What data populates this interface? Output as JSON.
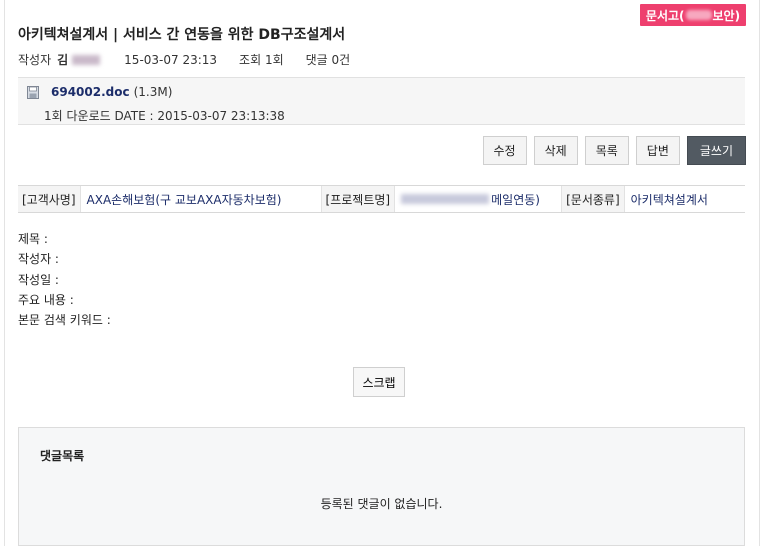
{
  "header": {
    "badge_prefix": "문서고(",
    "badge_suffix": "보안)",
    "title": "아키텍쳐설계서 | 서비스 간 연동을 위한 DB구조설계서"
  },
  "meta": {
    "author_label": "작성자",
    "author_initial": "김",
    "date": "15-03-07 23:13",
    "views": "조회 1회",
    "comments": "댓글 0건"
  },
  "attachment": {
    "icon": "floppy-disk-icon",
    "filename": "694002.doc",
    "size": "(1.3M)",
    "download_info": "1회 다운로드 DATE : 2015-03-07 23:13:38"
  },
  "actions": {
    "edit": "수정",
    "delete": "삭제",
    "list": "목록",
    "reply": "답변",
    "write": "글쓰기"
  },
  "info": {
    "customer_label": "[고객사명]",
    "customer_value": "AXA손해보험(구 교보AXA자동차보험)",
    "project_label": "[프로젝트명]",
    "project_value_suffix": "메일연동)",
    "doctype_label": "[문서종류]",
    "doctype_value": "아키텍쳐설계서"
  },
  "fields": {
    "subject": "제목 :",
    "writer": "작성자 :",
    "written_date": "작성일 :",
    "main_content": "주요 내용 :",
    "keywords": "본문 검색 키워드 :"
  },
  "scrap": "스크랩",
  "comments": {
    "heading": "댓글목록",
    "empty": "등록된 댓글이 없습니다."
  },
  "colors": {
    "badge": "#ee3f6e",
    "link": "#1c2d6a",
    "write_button": "#525a62"
  }
}
